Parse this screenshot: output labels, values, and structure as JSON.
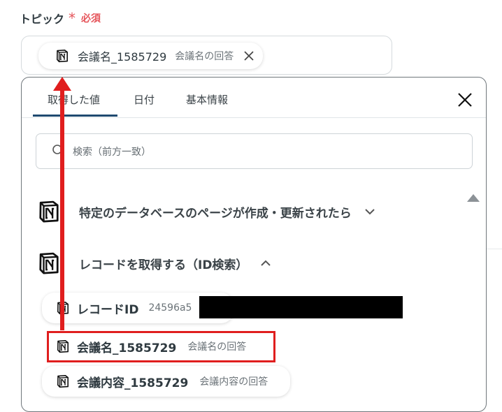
{
  "field": {
    "label": "トピック",
    "required_mark": "*",
    "required_text": "必須"
  },
  "selected_chip": {
    "name": "会議名_1585729",
    "sub": "会議名の回答",
    "icon": "notion-icon"
  },
  "tabs": [
    {
      "label": "取得した値",
      "active": true
    },
    {
      "label": "日付",
      "active": false
    },
    {
      "label": "基本情報",
      "active": false
    }
  ],
  "search": {
    "placeholder": "検索（前方一致）"
  },
  "sections": [
    {
      "label": "特定のデータベースのページが作成・更新されたら",
      "expanded": false
    },
    {
      "label": "レコードを取得する（ID検索）",
      "expanded": true
    }
  ],
  "items": [
    {
      "name": "レコードID",
      "sub": "24596a5"
    },
    {
      "name": "会議名_1585729",
      "sub": "会議名の回答"
    },
    {
      "name": "会議内容_1585729",
      "sub": "会議内容の回答"
    }
  ],
  "colors": {
    "required": "#e5555b",
    "annotation": "#e01e1e",
    "tab_underline": "#1f4a70"
  }
}
